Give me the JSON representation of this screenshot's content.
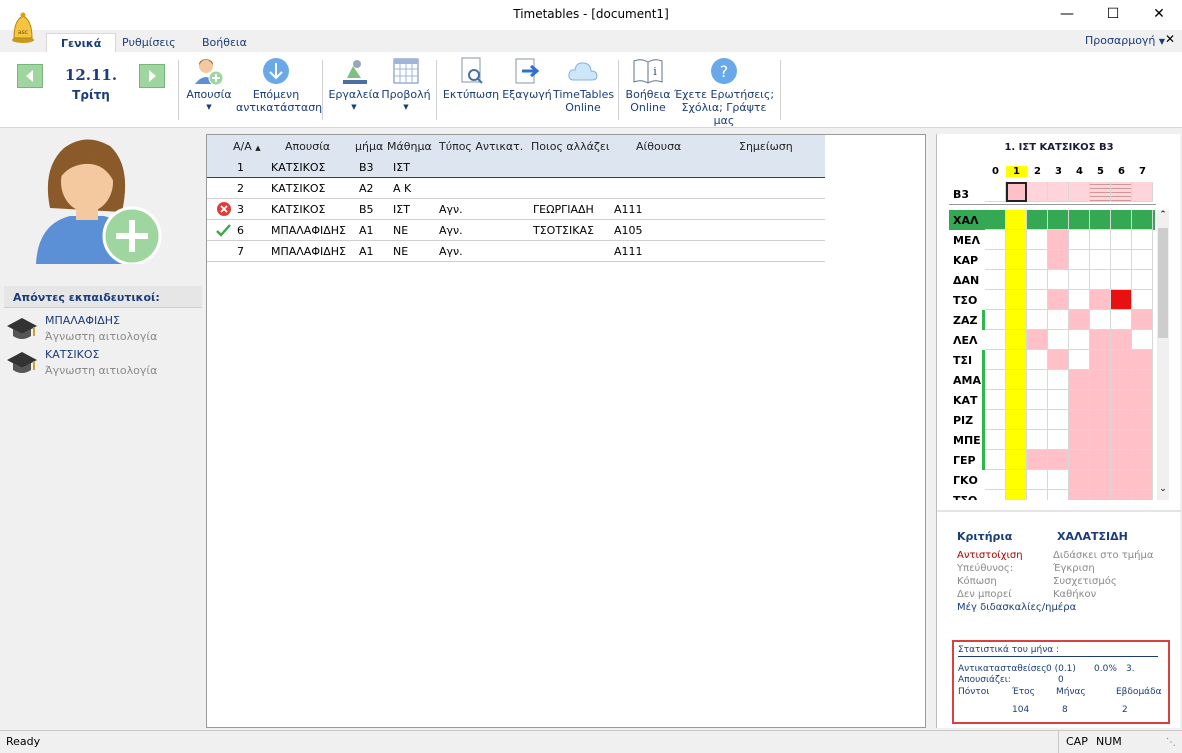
{
  "window": {
    "title": "Timetables - [document1]"
  },
  "tabs": [
    {
      "label": "Γενικά"
    },
    {
      "label": "Ρυθμίσεις"
    },
    {
      "label": "Βοήθεια"
    }
  ],
  "customize_label": "Προσαρμογή",
  "date": {
    "day": "12.11.",
    "weekday": "Τρίτη"
  },
  "ribbon": {
    "absence": "Απουσία",
    "next_line1": "Επόμενη",
    "next_line2": "αντικατάσταση",
    "tools": "Εργαλεία",
    "view": "Προβολή",
    "print": "Εκτύπωση",
    "export": "Εξαγωγή",
    "online_line1": "TimeTables",
    "online_line2": "Online",
    "help_line1": "Βοήθεια",
    "help_line2": "Online",
    "questions_line1": "Έχετε Ερωτήσεις;",
    "questions_line2": "Σχόλια; Γράψτε μας"
  },
  "left": {
    "absent_heading": "Απόντες εκπαιδευτικοί:",
    "teachers": [
      {
        "name": "ΜΠΑΛΑΦΙΔΗΣ",
        "reason": "Άγνωστη αιτιολογία"
      },
      {
        "name": "ΚΑΤΣΙΚΟΣ",
        "reason": "Άγνωστη αιτιολογία"
      }
    ]
  },
  "table": {
    "headers": [
      "Α/Α",
      "Απουσία",
      "μήμα",
      "Μάθημα",
      "Τύπος Αντικατ.",
      "Ποιος αλλάζει",
      "Αίθουσα",
      "Σημείωση"
    ],
    "rows": [
      {
        "no": "1",
        "absent": "ΚΑΤΣΙΚΟΣ",
        "class": "Β3",
        "subject": "ΙΣΤ",
        "type": "",
        "who": "",
        "room": "",
        "note": "",
        "status": "none"
      },
      {
        "no": "2",
        "absent": "ΚΑΤΣΙΚΟΣ",
        "class": "Α2",
        "subject": "Α Κ",
        "type": "",
        "who": "",
        "room": "",
        "note": "",
        "status": "none"
      },
      {
        "no": "3",
        "absent": "ΚΑΤΣΙΚΟΣ",
        "class": "Β5",
        "subject": "ΙΣΤ",
        "type": "Αγν.",
        "who": "ΓΕΩΡΓΙΑΔΗ",
        "room": "Α111",
        "note": "",
        "status": "error"
      },
      {
        "no": "6",
        "absent": "ΜΠΑΛΑΦΙΔΗΣ",
        "class": "Α1",
        "subject": "ΝΕ",
        "type": "Αγν.",
        "who": "ΤΣΟΤΣΙΚΑΣ",
        "room": "Α105",
        "note": "",
        "status": "ok"
      },
      {
        "no": "7",
        "absent": "ΜΠΑΛΑΦΙΔΗΣ",
        "class": "Α1",
        "subject": "ΝΕ",
        "type": "Αγν.",
        "who": "",
        "room": "Α111",
        "note": "",
        "status": "none"
      }
    ]
  },
  "timetable": {
    "title": "1. ΙΣΤ ΚΑΤΣΙΚΟΣ Β3",
    "periods": [
      "0",
      "1",
      "2",
      "3",
      "4",
      "5",
      "6",
      "7"
    ],
    "class_label": "Β3",
    "teachers": [
      "ΧΑΛ",
      "ΜΕΛ",
      "ΚΑΡ",
      "ΔΑΝ",
      "ΤΣΟ",
      "ΖΑΖ",
      "ΛΕΛ",
      "ΤΣΙ",
      "ΑΜΑ",
      "ΚΑΤ",
      "ΡΙΖ",
      "ΜΠΕ",
      "ΓΕΡ",
      "ΓΚΟ",
      "ΤΣΟ"
    ],
    "colors": {
      "highlight": "#ffff00",
      "busy": "#ffc0c8",
      "selected": "#34a853",
      "conflict": "#e81010"
    }
  },
  "criteria": {
    "title": "Κριτήρια",
    "teacher": "ΧΑΛΑΤΣΙΔΗ",
    "items_left": [
      "Αντιστοίχιση",
      "Υπεύθυνος:",
      "Κόπωση",
      "Δεν μπορεί",
      "Μέγ διδασκαλίες/ημέρα"
    ],
    "items_right": [
      "Διδάσκει στο τμήμα",
      "Έγκριση",
      "Συσχετισμός",
      "Καθήκον"
    ]
  },
  "stats": {
    "title": "Στατιστικά του μήνα :",
    "subs_label": "Αντικατασταθείσες",
    "subs_value": "0 (0.1)",
    "subs_pct": "0.0%",
    "subs_rank": "3.",
    "absent_label": "Απουσιάζει:",
    "absent_value": "0",
    "points_label": "Πόντοι",
    "year_label": "Έτος",
    "month_label": "Μήνας",
    "week_label": "Εβδομάδα",
    "year_value": "104",
    "month_value": "8",
    "week_value": "2"
  },
  "status": {
    "ready": "Ready",
    "cap": "CAP",
    "num": "NUM"
  }
}
